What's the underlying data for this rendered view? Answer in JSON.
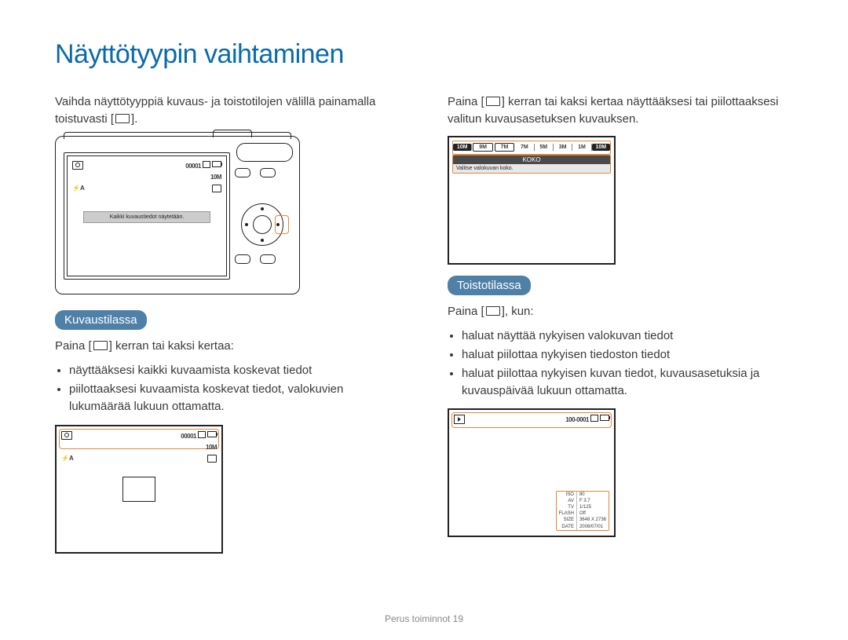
{
  "title": "Näyttötyypin vaihtaminen",
  "left": {
    "intro": "Vaihda näyttötyyppiä kuvaus- ja toistotilojen välillä painamalla toistuvasti [",
    "intro_end": "].",
    "camera_overlay": "Kaikki kuvaustiedot näytetään.",
    "counter": "00001",
    "res": "10M",
    "flash": "⚡A",
    "badge": "Kuvaustilassa",
    "press": "Paina [",
    "press_end": "] kerran tai kaksi kertaa:",
    "bullets": [
      "näyttääksesi kaikki kuvaamista koskevat tiedot",
      "piilottaaksesi kuvaamista koskevat tiedot, valokuvien lukumäärää lukuun ottamatta."
    ]
  },
  "right": {
    "intro": "Paina [",
    "intro_mid": "] kerran tai kaksi kertaa näyttääksesi tai piilottaaksesi valitun kuvausasetuksen kuvauksen.",
    "sizebar": [
      "10M",
      "9M",
      "7M",
      "7M",
      "5M",
      "3M",
      "1M",
      "10M"
    ],
    "size_title": "KOKO",
    "size_desc": "Valitse valokuvan koko.",
    "badge": "Toistotilassa",
    "press": "Paina [",
    "press_end": "], kun:",
    "bullets": [
      "haluat näyttää nykyisen valokuvan tiedot",
      "haluat piilottaa nykyisen tiedoston tiedot",
      "haluat piilottaa nykyisen kuvan tiedot, kuvausasetuksia ja kuvauspäivää lukuun ottamatta."
    ],
    "play_counter": "100-0001",
    "info": {
      "ISO": "80",
      "AV": "F 3.7",
      "TV": "1/125",
      "FLASH": "Off",
      "SIZE": "3648 X 2736",
      "DATE": "2008/07/01"
    }
  },
  "footer": "Perus toiminnot  19"
}
